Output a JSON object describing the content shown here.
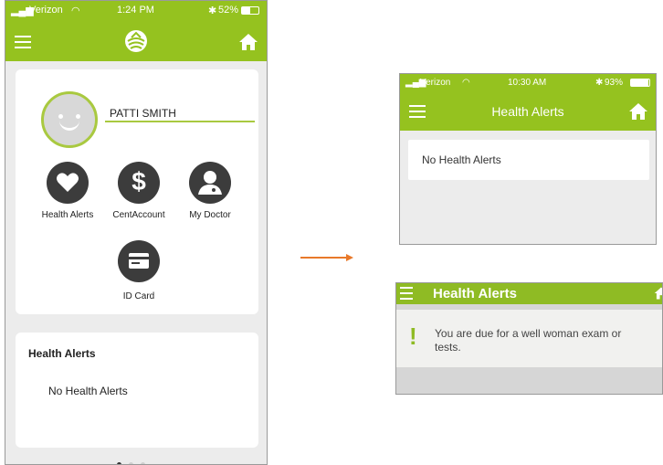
{
  "left_phone": {
    "status": {
      "carrier": "Verizon",
      "time": "1:24 PM",
      "battery": "52%"
    },
    "profile": {
      "name": "PATTI SMITH"
    },
    "tiles": [
      {
        "label": "Health Alerts",
        "icon": "heart-icon"
      },
      {
        "label": "CentAccount",
        "icon": "dollar-icon"
      },
      {
        "label": "My Doctor",
        "icon": "doctor-icon"
      },
      {
        "label": "ID Card",
        "icon": "id-card-icon"
      }
    ],
    "alerts_card": {
      "title": "Health Alerts",
      "message": "No Health Alerts"
    },
    "pager": {
      "pages": 3,
      "active": 1
    }
  },
  "right_top_phone": {
    "status": {
      "carrier": "Verizon",
      "time": "10:30 AM",
      "battery": "93%"
    },
    "title": "Health Alerts",
    "message": "No Health Alerts"
  },
  "right_bottom_phone": {
    "title": "Health Alerts",
    "alert_text": "You are due for a well woman exam or tests."
  },
  "colors": {
    "brand_green": "#95c21f",
    "arrow_orange": "#e8792a",
    "icon_dark": "#3c3c3c"
  }
}
